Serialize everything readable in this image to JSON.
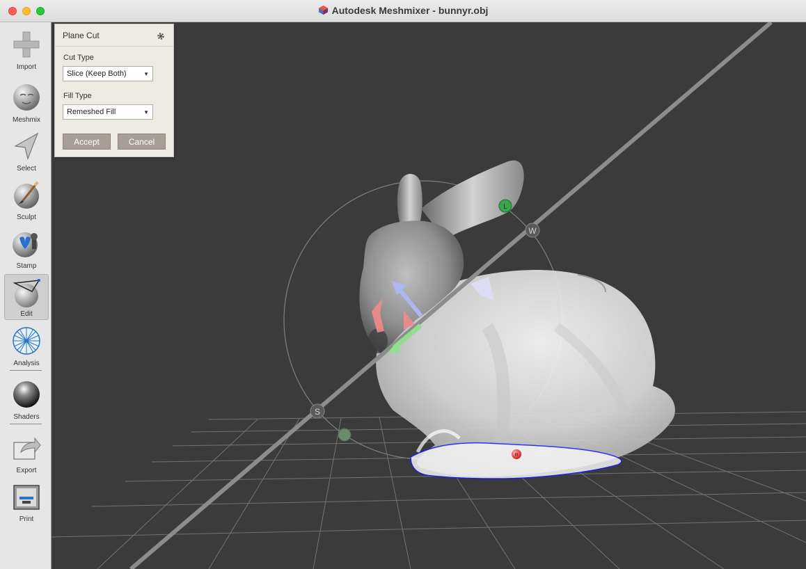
{
  "window": {
    "title": "Autodesk Meshmixer - bunnyr.obj"
  },
  "toolbar": {
    "items": [
      {
        "label": "Import",
        "icon": "plus-icon"
      },
      {
        "label": "Meshmix",
        "icon": "meshmix-face-icon"
      },
      {
        "label": "Select",
        "icon": "select-arrow-icon"
      },
      {
        "label": "Sculpt",
        "icon": "sculpt-brush-icon"
      },
      {
        "label": "Stamp",
        "icon": "stamp-icon"
      },
      {
        "label": "Edit",
        "icon": "edit-icon",
        "active": true
      },
      {
        "label": "Analysis",
        "icon": "analysis-mesh-icon"
      },
      {
        "label": "Shaders",
        "icon": "shaders-sphere-icon"
      },
      {
        "label": "Export",
        "icon": "export-icon"
      },
      {
        "label": "Print",
        "icon": "print-icon"
      }
    ]
  },
  "plane_cut_panel": {
    "title": "Plane Cut",
    "cut_type_label": "Cut Type",
    "cut_type_value": "Slice (Keep Both)",
    "fill_type_label": "Fill Type",
    "fill_type_value": "Remeshed Fill",
    "accept_label": "Accept",
    "cancel_label": "Cancel"
  },
  "gizmo": {
    "handle_w": "W",
    "handle_s": "S",
    "handle_l": "L",
    "handle_r": "R"
  },
  "colors": {
    "viewport_background": "#3b3b3b",
    "panel_background": "#ede9e3",
    "button_background": "#a69e97",
    "cut_outline": "#1a1aff"
  }
}
